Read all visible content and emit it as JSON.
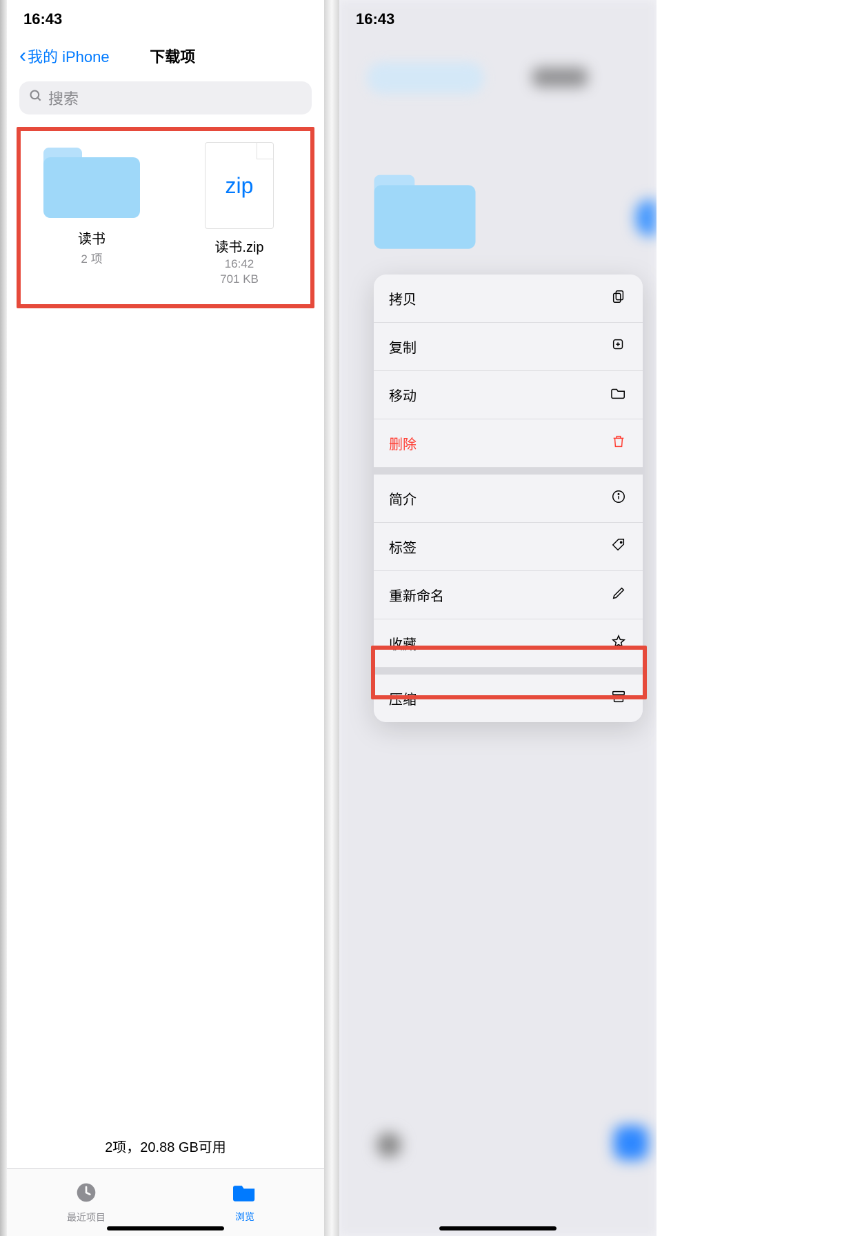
{
  "left": {
    "time": "16:43",
    "back_label": "我的 iPhone",
    "title": "下载项",
    "search_placeholder": "搜索",
    "items": [
      {
        "name": "读书",
        "meta1": "2 项"
      },
      {
        "name": "读书.zip",
        "meta1": "16:42",
        "meta2": "701 KB",
        "ziplabel": "zip"
      }
    ],
    "footer": "2项，20.88 GB可用",
    "tabs": {
      "recent": "最近项目",
      "browse": "浏览"
    }
  },
  "right": {
    "time": "16:43",
    "menu": {
      "copy": "拷贝",
      "duplicate": "复制",
      "move": "移动",
      "delete": "删除",
      "info": "简介",
      "tags": "标签",
      "rename": "重新命名",
      "favorite": "收藏",
      "compress": "压缩"
    }
  }
}
